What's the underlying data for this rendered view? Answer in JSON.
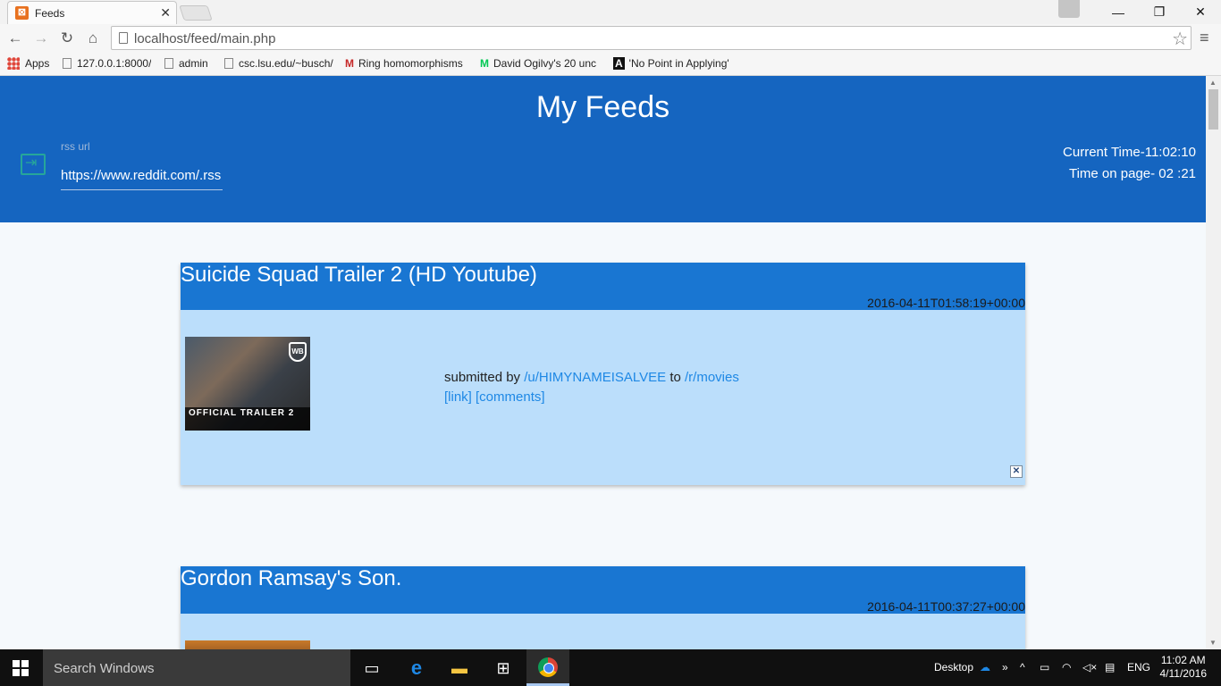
{
  "browser": {
    "tab_title": "Feeds",
    "tab_favicon": "xampp-icon",
    "url": "localhost/feed/main.php",
    "bookmarks": [
      {
        "label": "Apps"
      },
      {
        "label": "127.0.0.1:8000/"
      },
      {
        "label": "admin"
      },
      {
        "label": "csc.lsu.edu/~busch/"
      },
      {
        "label": "Ring homomorphisms"
      },
      {
        "label": "David Ogilvy's 20 unc"
      },
      {
        "label": "'No Point in Applying'"
      }
    ]
  },
  "header": {
    "title": "My Feeds",
    "rss_label": "rss url",
    "rss_value": "https://www.reddit.com/.rss",
    "current_time": "Current Time-11:02:10",
    "time_on_page": "Time on page- 02 :21"
  },
  "feeds": [
    {
      "title": "Suicide Squad Trailer 2 (HD Youtube)",
      "date": "2016-04-11T01:58:19+00:00",
      "thumb_label": "OFFICIAL TRAILER 2",
      "submitted_prefix": "submitted by",
      "user": "/u/HIMYNAMEISALVEE",
      "to": "to",
      "subreddit": "/r/movies",
      "link": "[link]",
      "comments": "[comments]",
      "close": "✕"
    },
    {
      "title": "Gordon Ramsay's Son.",
      "date": "2016-04-11T00:37:27+00:00"
    }
  ],
  "taskbar": {
    "search_placeholder": "Search Windows",
    "desktop_label": "Desktop",
    "language": "ENG",
    "time": "11:02 AM",
    "date": "4/11/2016"
  }
}
